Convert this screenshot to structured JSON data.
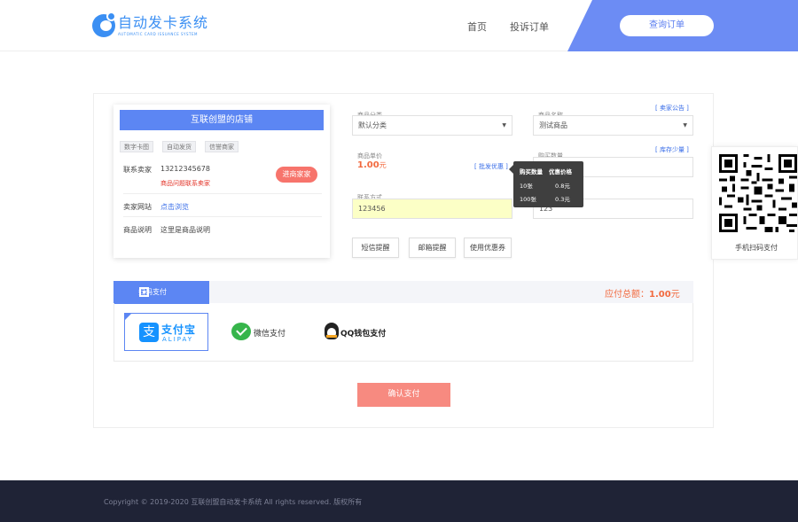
{
  "header": {
    "logo_title": "自动发卡系统",
    "logo_subtitle": "AUTOMATIC CARD ISSUANCE SYSTEM",
    "nav": [
      "首页",
      "投诉订单"
    ],
    "query_button": "查询订单"
  },
  "store": {
    "name": "互联创盟的店铺",
    "tags": [
      "数字卡图",
      "自动发货",
      "信誉商家"
    ],
    "contact_label": "联系卖家",
    "contact_value": "13212345678",
    "contact_note": "商品问题联系卖家",
    "contact_button": "进商家家",
    "website_label": "卖家网站",
    "website_value": "点击浏览",
    "desc_label": "商品说明",
    "desc_value": "这里是商品说明"
  },
  "form": {
    "notice_link": "[ 卖家公告 ]",
    "category_label": "商品分类",
    "category_value": "默认分类",
    "product_label": "商品名称",
    "product_value": "测试商品",
    "price_label": "商品单价",
    "price_value": "1.00",
    "price_unit": "元",
    "discount_link": "[ 批发优惠 ]",
    "stock_link": "[ 库存少量 ]",
    "qty_label": "购买数量",
    "qty_value": "",
    "contact_label": "联系方式",
    "contact_value": "123456",
    "extra_value": "123",
    "buttons": [
      "短信提醒",
      "邮箱提醒",
      "使用优惠券"
    ]
  },
  "tooltip": {
    "headers": [
      "购买数量",
      "优惠价格"
    ],
    "rows": [
      {
        "qty": "10张",
        "price": "0.8元"
      },
      {
        "qty": "100张",
        "price": "0.3元"
      }
    ]
  },
  "payment": {
    "tab_label": "扫码支付",
    "total_label": "应付总额：",
    "total_value": "1.00",
    "total_unit": "元",
    "methods": {
      "alipay_cn": "支付宝",
      "alipay_en": "ALIPAY",
      "wechat": "微信支付",
      "qq": "QQ钱包支付"
    },
    "confirm_button": "确认支付"
  },
  "side": {
    "caption": "手机扫码支付"
  },
  "footer": {
    "copyright": "Copyright © 2019-2020 互联创盟自动发卡系统 All rights reserved. 版权所有"
  },
  "colors": {
    "brand_blue": "#5c86f3",
    "accent_red": "#f7746c",
    "footer_bg": "#1f2336"
  }
}
